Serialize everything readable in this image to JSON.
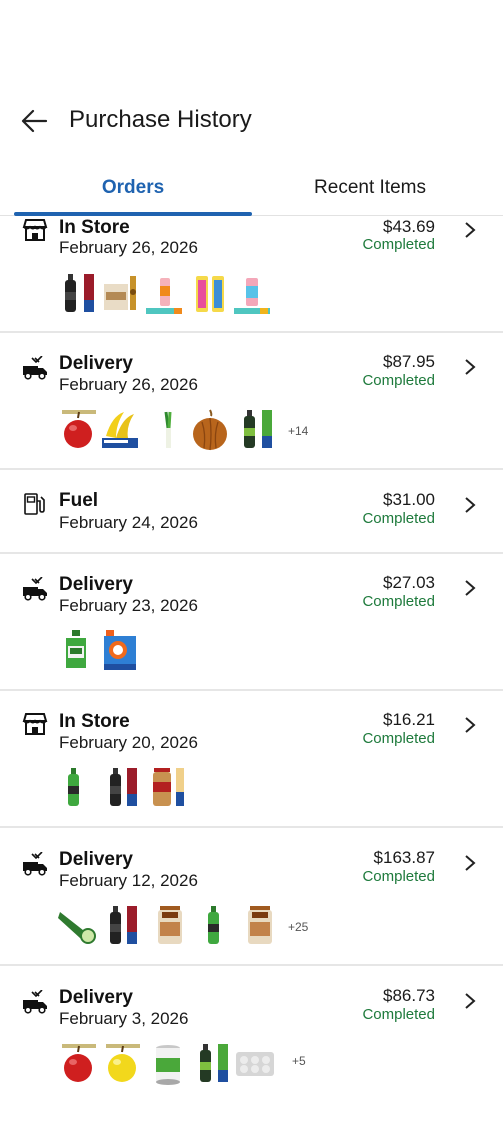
{
  "header": {
    "title": "Purchase History",
    "back_icon": "arrow-left-icon"
  },
  "tabs": [
    {
      "label": "Orders",
      "active": true
    },
    {
      "label": "Recent Items",
      "active": false
    }
  ],
  "colors": {
    "accent": "#1f63b0",
    "status_green": "#1e7a3c"
  },
  "orders": [
    {
      "type": "In Store",
      "icon": "store-icon",
      "date": "February 26, 2026",
      "amount": "$43.69",
      "status": "Completed",
      "items": [
        "soda-bottle-product",
        "snack-bag-product",
        "snack-box-product",
        "drink-can-product",
        "candy-bar-product",
        "drink-can-product"
      ],
      "more": ""
    },
    {
      "type": "Delivery",
      "icon": "delivery-truck-icon",
      "date": "February 26, 2026",
      "amount": "$87.95",
      "status": "Completed",
      "items": [
        "apple-product",
        "bananas-product",
        "leek-product",
        "onion-product",
        "soda-bottle-product"
      ],
      "more": "+14"
    },
    {
      "type": "Fuel",
      "icon": "fuel-pump-icon",
      "date": "February 24, 2026",
      "amount": "$31.00",
      "status": "Completed",
      "items": [],
      "more": ""
    },
    {
      "type": "Delivery",
      "icon": "delivery-truck-icon",
      "date": "February 23, 2026",
      "amount": "$27.03",
      "status": "Completed",
      "items": [
        "dish-soap-product",
        "detergent-product"
      ],
      "more": ""
    },
    {
      "type": "In Store",
      "icon": "store-icon",
      "date": "February 20, 2026",
      "amount": "$16.21",
      "status": "Completed",
      "items": [
        "soda-bottle-product",
        "soda-bottle-product",
        "peanuts-jar-product"
      ],
      "more": ""
    },
    {
      "type": "Delivery",
      "icon": "delivery-truck-icon",
      "date": "February 12, 2026",
      "amount": "$163.87",
      "status": "Completed",
      "items": [
        "cucumber-product",
        "soda-bottle-product",
        "cereal-bag-product",
        "soda-bottle-product",
        "cereal-bag-product"
      ],
      "more": "+25"
    },
    {
      "type": "Delivery",
      "icon": "delivery-truck-icon",
      "date": "February 3, 2026",
      "amount": "$86.73",
      "status": "Completed",
      "items": [
        "apple-product",
        "yellow-apple-product",
        "canned-vegetable-product",
        "soda-bottle-product",
        "eggs-carton-product"
      ],
      "more": "+5"
    }
  ]
}
